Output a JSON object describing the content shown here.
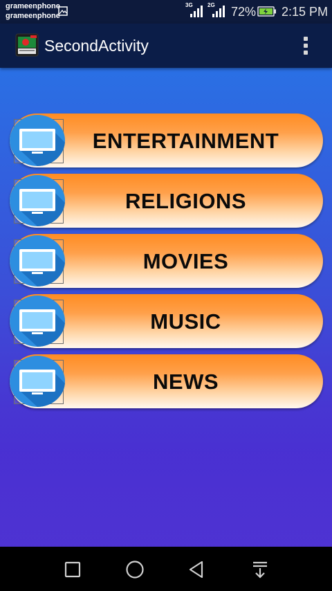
{
  "status_bar": {
    "carrier_1": "grameenphone",
    "carrier_2": "grameenphone",
    "network_1": "3G",
    "network_2": "2G",
    "battery_percent": "72%",
    "time": "2:15 PM",
    "icons": [
      "image-notification-icon",
      "signal-3g-icon",
      "signal-2g-icon",
      "battery-charging-icon"
    ]
  },
  "app_bar": {
    "title": "SecondActivity",
    "app_icon": "app-logo-icon",
    "menu_icon": "overflow-menu-icon"
  },
  "menu": {
    "items": [
      {
        "label": "ENTERTAINMENT",
        "icon": "tv-icon"
      },
      {
        "label": "RELIGIONS",
        "icon": "tv-icon"
      },
      {
        "label": "MOVIES",
        "icon": "tv-icon"
      },
      {
        "label": "MUSIC",
        "icon": "tv-icon"
      },
      {
        "label": "NEWS",
        "icon": "tv-icon"
      }
    ]
  },
  "nav_bar": {
    "buttons": [
      "recents-square-icon",
      "home-circle-icon",
      "back-triangle-icon",
      "notifications-pull-down-icon"
    ]
  },
  "colors": {
    "app_bar": "#0b1d48",
    "status_bar": "#0d1a3c",
    "background_top": "#2a70e4",
    "background_bottom": "#5a26cc",
    "button_orange": "#ff8c22",
    "tv_circle": "#2d8ee0"
  }
}
